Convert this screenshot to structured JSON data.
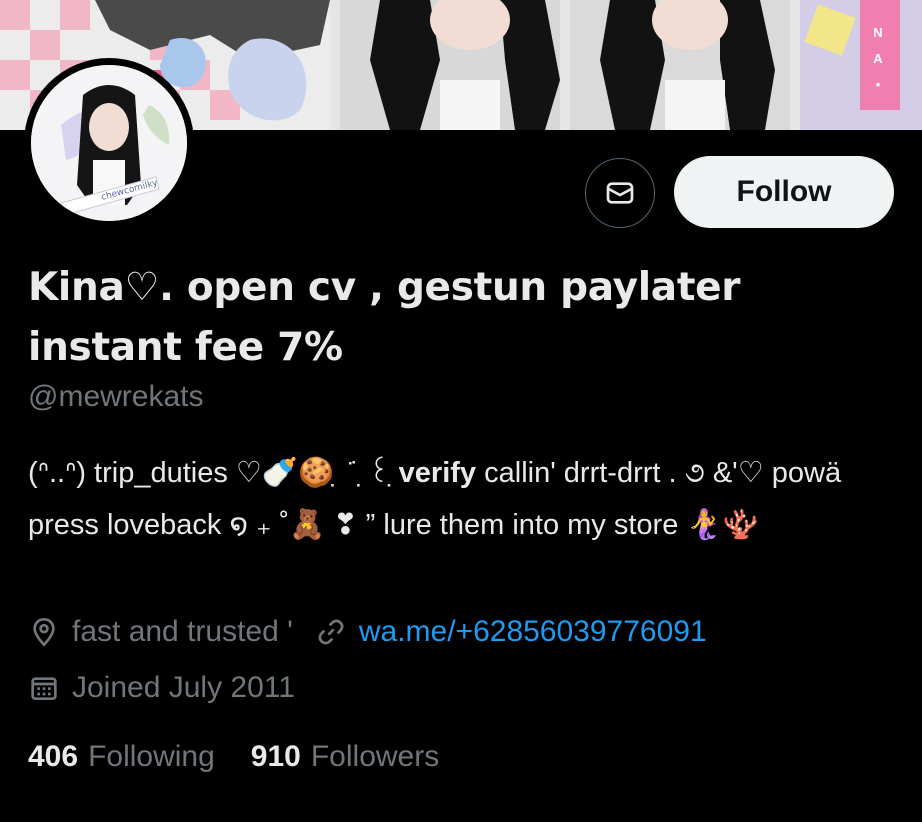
{
  "profile": {
    "display_name": "Kina♡. open cv , gestun paylater instant fee 7%",
    "handle": "@mewrekats",
    "avatar_caption": "chewcomilky",
    "bio": {
      "part1": "(ᐢ..ᐢ) trip_duties ♡🍼🍪 ̣ ̇˙ ̣꒰ ̣",
      "verify": "verify",
      "part2": " callin' drrt-drrt . ૭ &'♡ powä press loveback ໑ ₊ ˚🧸 ❣ ” lure them into my store 🧜‍♀️🪸"
    },
    "location": "fast and trusted '",
    "link": "wa.me/+62856039776091",
    "joined": "Joined July 2011",
    "following_count": "406",
    "following_label": "Following",
    "followers_count": "910",
    "followers_label": "Followers"
  },
  "actions": {
    "follow_label": "Follow"
  },
  "banner": {
    "side_letters": [
      "N",
      "A",
      "•"
    ]
  },
  "colors": {
    "background": "#000000",
    "text_primary": "#e7e9ea",
    "text_secondary": "#71767b",
    "link": "#1d9bf0",
    "button_bg": "#eff3f4"
  },
  "icons": {
    "message": "envelope-icon",
    "location": "location-pin-icon",
    "link": "link-icon",
    "joined": "calendar-icon"
  }
}
